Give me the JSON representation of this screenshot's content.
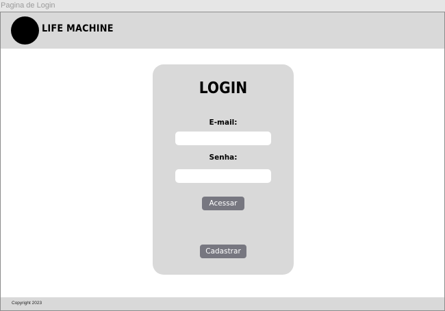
{
  "window": {
    "title": "Pagina de Login"
  },
  "header": {
    "brand": "LIFE MACHINE",
    "logo_icon": "black-circle-logo"
  },
  "login": {
    "title": "LOGIN",
    "email_label": "E-mail:",
    "email_value": "",
    "password_label": "Senha:",
    "password_value": "",
    "submit_label": "Acessar",
    "register_label": "Cadastrar"
  },
  "footer": {
    "copyright": "Copyright 2023"
  },
  "colors": {
    "header_bg": "#d9d9d9",
    "card_bg": "#d9d9d9",
    "button_bg": "#777780",
    "button_text": "#ffffff"
  }
}
